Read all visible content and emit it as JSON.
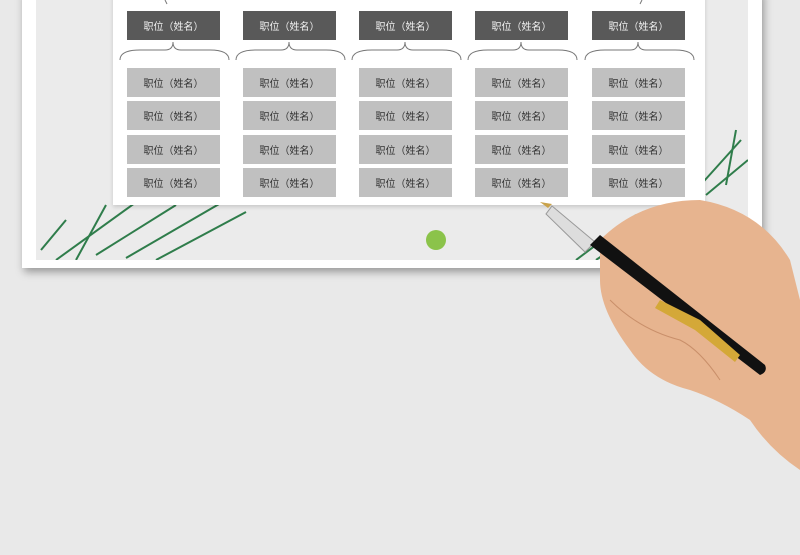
{
  "org_chart": {
    "managers": [
      "职位（姓名）",
      "职位（姓名）",
      "职位（姓名）",
      "职位（姓名）",
      "职位（姓名）"
    ],
    "staff": [
      [
        "职位（姓名）",
        "职位（姓名）",
        "职位（姓名）",
        "职位（姓名）"
      ],
      [
        "职位（姓名）",
        "职位（姓名）",
        "职位（姓名）",
        "职位（姓名）"
      ],
      [
        "职位（姓名）",
        "职位（姓名）",
        "职位（姓名）",
        "职位（姓名）"
      ],
      [
        "职位（姓名）",
        "职位（姓名）",
        "职位（姓名）",
        "职位（姓名）"
      ],
      [
        "职位（姓名）",
        "职位（姓名）",
        "职位（姓名）",
        "职位（姓名）"
      ]
    ]
  },
  "colors": {
    "manager_box": "#595959",
    "staff_box": "#c0c0c0",
    "leaf_green": "#2e7d4a"
  }
}
